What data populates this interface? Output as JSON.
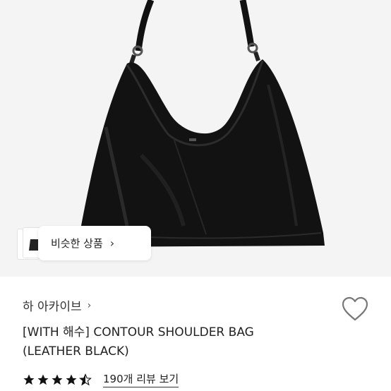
{
  "hero": {
    "similar_button": {
      "label": "비슷한 상품",
      "chevron_icon": "chevron-right-icon"
    }
  },
  "product": {
    "shop_name": "하 아카이브",
    "title_line1": "[WITH 해수] CONTOUR SHOULDER BAG",
    "title_line2": "(LEATHER BLACK)",
    "rating_stars": 4.5,
    "review_link": "190개 리뷰 보기"
  },
  "icons": {
    "wishlist": "heart-icon",
    "star": "star-icon"
  },
  "colors": {
    "hero_bg": "#f4f4f4",
    "bag": "#111111",
    "text": "#222222"
  }
}
